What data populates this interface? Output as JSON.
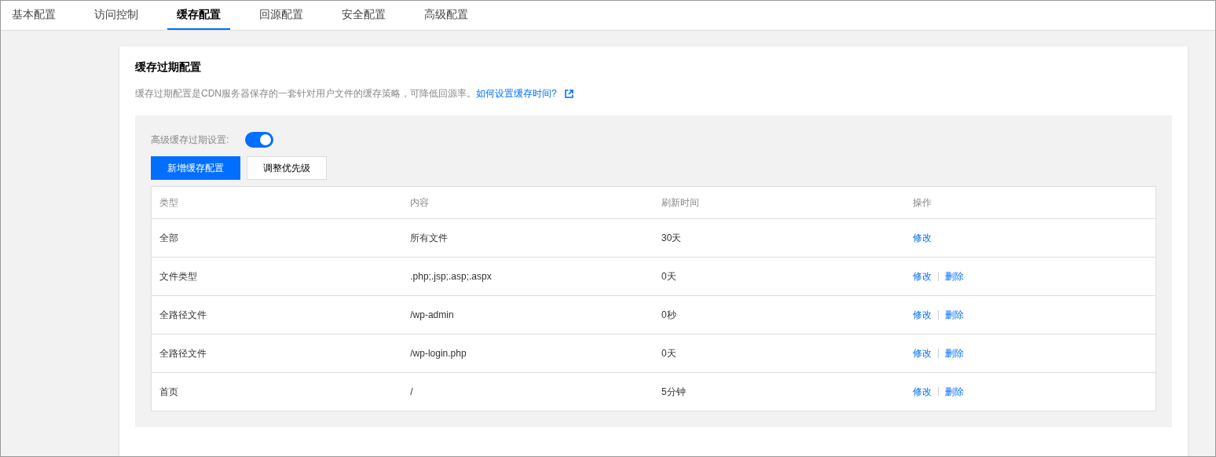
{
  "tabs": [
    {
      "label": "基本配置",
      "selected": false
    },
    {
      "label": "访问控制",
      "selected": false
    },
    {
      "label": "缓存配置",
      "selected": true
    },
    {
      "label": "回源配置",
      "selected": false
    },
    {
      "label": "安全配置",
      "selected": false
    },
    {
      "label": "高级配置",
      "selected": false
    }
  ],
  "card": {
    "title": "缓存过期配置",
    "description": "缓存过期配置是CDN服务器保存的一套针对用户文件的缓存策略，可降低回源率。",
    "help_link": "如何设置缓存时间?",
    "advanced_setting": {
      "label": "高级缓存过期设置:",
      "on": true
    },
    "buttons": [
      {
        "label": "新增缓存配置",
        "kind": "primary"
      },
      {
        "label": "调整优先级",
        "kind": "default"
      }
    ],
    "table": {
      "columns": [
        "类型",
        "内容",
        "刷新时间",
        "操作"
      ],
      "rows": [
        {
          "type": "全部",
          "content": "所有文件",
          "refresh": "30天",
          "actions": [
            "修改"
          ]
        },
        {
          "type": "文件类型",
          "content": ".php;.jsp;.asp;.aspx",
          "refresh": "0天",
          "actions": [
            "修改",
            "删除"
          ]
        },
        {
          "type": "全路径文件",
          "content": "/wp-admin",
          "refresh": "0秒",
          "actions": [
            "修改",
            "删除"
          ]
        },
        {
          "type": "全路径文件",
          "content": "/wp-login.php",
          "refresh": "0天",
          "actions": [
            "修改",
            "删除"
          ]
        },
        {
          "type": "首页",
          "content": "/",
          "refresh": "5分钟",
          "actions": [
            "修改",
            "删除"
          ]
        }
      ]
    }
  }
}
